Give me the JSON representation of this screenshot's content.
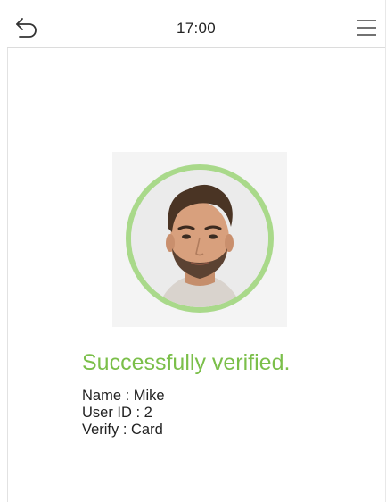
{
  "header": {
    "time": "17:00",
    "back_icon": "back-arrow-icon",
    "menu_icon": "hamburger-menu-icon"
  },
  "result": {
    "status_text": "Successfully verified.",
    "status_color": "#7bbf4a",
    "ring_color": "#a9d98a",
    "name_line": "Name : Mike",
    "userid_line": "User ID : 2",
    "verify_line": "Verify : Card"
  }
}
